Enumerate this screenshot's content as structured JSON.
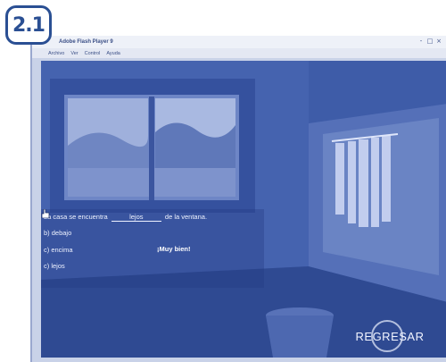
{
  "badge": {
    "label": "2.1"
  },
  "window": {
    "title": "Adobe Flash Player 9",
    "controls": [
      "-",
      "□",
      "×"
    ],
    "menu": [
      "Archivo",
      "Ver",
      "Control",
      "Ayuda"
    ]
  },
  "exercise": {
    "sentence_before": "La casa se encuentra",
    "answer": "lejos",
    "sentence_after": "de la ventana.",
    "options": [
      "b) debajo",
      "c) encima",
      "c) lejos"
    ],
    "feedback": "¡Muy bien!"
  },
  "actions": {
    "back_label": "REGRESAR"
  },
  "colors": {
    "scene": "#3d5aa6",
    "accent": "#2a4f93"
  }
}
